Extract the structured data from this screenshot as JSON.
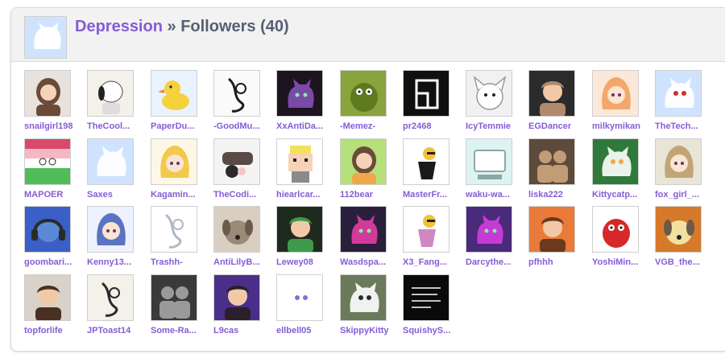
{
  "header": {
    "owner": "Depression",
    "separator": " » ",
    "title": "Followers (40)"
  },
  "followers": [
    {
      "username": "snailgirl198",
      "bg": "#e9e2dc",
      "fg": "#6b4a3a",
      "icon": "girl-avatar"
    },
    {
      "username": "TheCool...",
      "bg": "#f4f0ea",
      "fg": "#3a3a3a",
      "icon": "snoopy-avatar"
    },
    {
      "username": "PaperDu...",
      "bg": "#e9f3ff",
      "fg": "#f5d23c",
      "icon": "duck-avatar"
    },
    {
      "username": "-GoodMu...",
      "bg": "#fafafa",
      "fg": "#1c1c1c",
      "icon": "sketch-avatar"
    },
    {
      "username": "XxAntiDa...",
      "bg": "#1d1420",
      "fg": "#7a4aa8",
      "icon": "dark-cat-avatar"
    },
    {
      "username": "-Memez-",
      "bg": "#89a43c",
      "fg": "#5e7a1f",
      "icon": "blob-avatar"
    },
    {
      "username": "pr2468",
      "bg": "#0f0f0f",
      "fg": "#ffffff",
      "icon": "logo-avatar"
    },
    {
      "username": "IcyTemmie",
      "bg": "#f1f1f1",
      "fg": "#9a9a9a",
      "icon": "temmie-avatar"
    },
    {
      "username": "EGDancer",
      "bg": "#2b2b2b",
      "fg": "#b08a6a",
      "icon": "boy-avatar"
    },
    {
      "username": "milkymikan",
      "bg": "#fbe8d8",
      "fg": "#f2a86a",
      "icon": "anime-avatar"
    },
    {
      "username": "TheTech...",
      "bg": "#cfe3ff",
      "fg": "#d62828",
      "icon": "cat-avatar"
    },
    {
      "username": "MAPOER",
      "bg": "#4fbd5a",
      "fg": "#d94a6a",
      "icon": "flag-avatar"
    },
    {
      "username": "Saxes",
      "bg": "#cfe3ff",
      "fg": "#ffffff",
      "icon": "cat-avatar"
    },
    {
      "username": "Kagamin...",
      "bg": "#fff7e6",
      "fg": "#f2c94c",
      "icon": "anime-avatar"
    },
    {
      "username": "TheCodi...",
      "bg": "#f4f4f4",
      "fg": "#5a4a44",
      "icon": "hand-avatar"
    },
    {
      "username": "hiearlcar...",
      "bg": "#ffffff",
      "fg": "#f2e25a",
      "icon": "pixel-avatar"
    },
    {
      "username": "112bear",
      "bg": "#b5e07a",
      "fg": "#f2a64a",
      "icon": "girl-avatar"
    },
    {
      "username": "MasterFr...",
      "bg": "#ffffff",
      "fg": "#1a1a1a",
      "icon": "figure-avatar"
    },
    {
      "username": "waku-wa...",
      "bg": "#dcf3f2",
      "fg": "#8aa7a6",
      "icon": "computer-avatar"
    },
    {
      "username": "liska222",
      "bg": "#5d4a3a",
      "fg": "#c29b77",
      "icon": "people-avatar"
    },
    {
      "username": "Kittycatp...",
      "bg": "#2f7a3a",
      "fg": "#f2a640",
      "icon": "cat-avatar"
    },
    {
      "username": "fox_girl_...",
      "bg": "#e9e4d8",
      "fg": "#c2a577",
      "icon": "anime-avatar"
    },
    {
      "username": "goombari...",
      "bg": "#3a5fc6",
      "fg": "#2a2a2a",
      "icon": "headphones-avatar"
    },
    {
      "username": "Kenny13...",
      "bg": "#eef2ff",
      "fg": "#5a73c2",
      "icon": "anime-avatar"
    },
    {
      "username": "Trashh-",
      "bg": "#ffffff",
      "fg": "#b0b8c6",
      "icon": "sketch-avatar"
    },
    {
      "username": "AntiLilyB...",
      "bg": "#d8cfc2",
      "fg": "#9a8a78",
      "icon": "dog-avatar"
    },
    {
      "username": "Lewey08",
      "bg": "#1f2a1f",
      "fg": "#3e9a4a",
      "icon": "boy-avatar"
    },
    {
      "username": "Wasdspa...",
      "bg": "#2a1f3a",
      "fg": "#d23a9a",
      "icon": "dark-cat-avatar"
    },
    {
      "username": "X3_Fang...",
      "bg": "#ffffff",
      "fg": "#d286c2",
      "icon": "figure-avatar"
    },
    {
      "username": "Darcythe...",
      "bg": "#4a2a7a",
      "fg": "#c63ad6",
      "icon": "dark-cat-avatar"
    },
    {
      "username": "pfhhh",
      "bg": "#e97a3a",
      "fg": "#6a3a1a",
      "icon": "boy-avatar"
    },
    {
      "username": "YoshiMin...",
      "bg": "#ffffff",
      "fg": "#d62828",
      "icon": "blob-avatar"
    },
    {
      "username": "VGB_the...",
      "bg": "#d67a2a",
      "fg": "#f2e0a0",
      "icon": "dog-avatar"
    },
    {
      "username": "topforlife",
      "bg": "#d8d2c8",
      "fg": "#4a3022",
      "icon": "boy-avatar"
    },
    {
      "username": "JPToast14",
      "bg": "#f4f0ea",
      "fg": "#2a2a2a",
      "icon": "sketch-avatar"
    },
    {
      "username": "Some-Ra...",
      "bg": "#3a3a3a",
      "fg": "#9a9a9a",
      "icon": "people-avatar"
    },
    {
      "username": "L9cas",
      "bg": "#4a2f8a",
      "fg": "#2a1f2a",
      "icon": "boy-avatar"
    },
    {
      "username": "ellbell05",
      "bg": "#ffffff",
      "fg": "#8a6ad6",
      "icon": "cat-avatar"
    },
    {
      "username": "SkippyKitty",
      "bg": "#6a7a5a",
      "fg": "#2a2a2a",
      "icon": "cat-avatar"
    },
    {
      "username": "SquishyS...",
      "bg": "#0a0a0a",
      "fg": "#ffffff",
      "icon": "text-avatar"
    }
  ]
}
